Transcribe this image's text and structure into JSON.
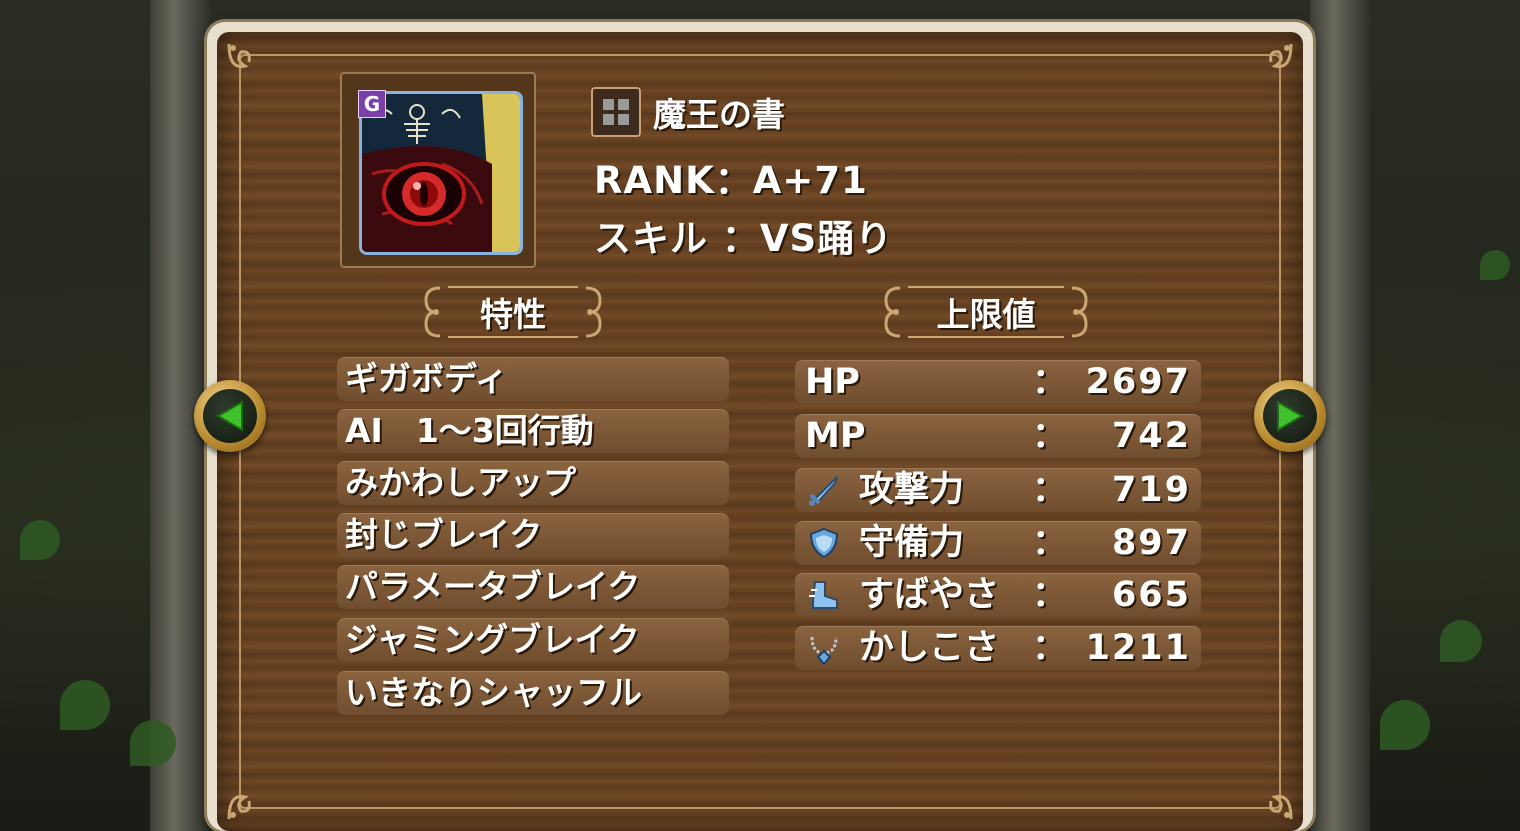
{
  "monster": {
    "name": "魔王の書",
    "rank_text": "RANK：A+71",
    "skill_text": "スキル ：VS踊り",
    "badge": "G"
  },
  "headers": {
    "traits": "特性",
    "stats": "上限値"
  },
  "traits": [
    "ギガボディ",
    "AI　1～3回行動",
    "みかわしアップ",
    "封じブレイク",
    "パラメータブレイク",
    "ジャミングブレイク",
    "いきなりシャッフル"
  ],
  "stats": [
    {
      "label": "HP",
      "colon": "：",
      "value": "2697",
      "icon": ""
    },
    {
      "label": "MP",
      "colon": "：",
      "value": "742",
      "icon": ""
    },
    {
      "label": "攻撃力",
      "colon": "：",
      "value": "719",
      "icon": "sword-icon"
    },
    {
      "label": "守備力",
      "colon": "：",
      "value": "897",
      "icon": "shield-icon"
    },
    {
      "label": "すばやさ",
      "colon": "：",
      "value": "665",
      "icon": "boot-icon"
    },
    {
      "label": "かしこさ",
      "colon": "：",
      "value": "1211",
      "icon": "necklace-icon"
    }
  ],
  "nav": {
    "prev_icon": "arrow-left-icon",
    "next_icon": "arrow-right-icon"
  },
  "colors": {
    "arrow_green": "#3fc22e",
    "panel_wood": "#6b4524",
    "trim_gold": "#c9a672"
  }
}
